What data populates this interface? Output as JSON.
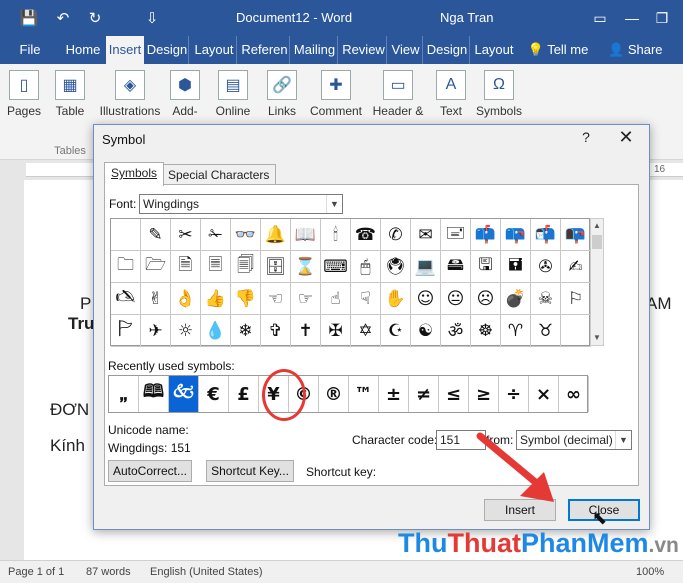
{
  "titlebar": {
    "doc_title": "Document12 - Word",
    "user": "Nga Tran",
    "save_icon": "💾",
    "undo_icon": "↶",
    "redo_icon": "↻",
    "qat_more": "⇩"
  },
  "tabs": [
    "File",
    "Home",
    "Insert",
    "Design",
    "Layout",
    "Referen",
    "Mailing",
    "Review",
    "View",
    "Design",
    "Layout",
    "Tell me",
    "Share"
  ],
  "ribbon": {
    "groups": [
      "Pages",
      "Table",
      "Illustrations",
      "Add-",
      "Online",
      "Links",
      "Comment",
      "Header &",
      "Text",
      "Symbols"
    ],
    "sub": [
      "Tables"
    ]
  },
  "document": {
    "ruler_label": "16",
    "fragments": [
      "P",
      "Tru",
      "AM",
      "ĐƠN",
      "Kính"
    ]
  },
  "statusbar": {
    "page": "Page 1 of 1",
    "words": "87 words",
    "language": "English (United States)",
    "zoom": "100%"
  },
  "dialog": {
    "title": "Symbol",
    "help": "?",
    "close_icon": "✕",
    "tab_symbols": "Symbols",
    "tab_special": "Special Characters",
    "font_label": "Font:",
    "font_value": "Wingdings",
    "symbol_grid": [
      [
        "",
        "✎",
        "✂",
        "✁",
        "👓",
        "🔔",
        "📖",
        "🕯",
        "☎",
        "✆",
        "✉",
        "🖃",
        "📫",
        "📪",
        "📬",
        "📭"
      ],
      [
        "🗀",
        "🗁",
        "🗎",
        "🗏",
        "🗐",
        "🗄",
        "⌛",
        "⌨",
        "🖱",
        "🖲",
        "💻",
        "🖴",
        "🖫",
        "🖬",
        "✇",
        "✍"
      ],
      [
        "🖎",
        "✌",
        "👌",
        "👍",
        "👎",
        "☜",
        "☞",
        "☝",
        "☟",
        "✋",
        "☺",
        "😐",
        "☹",
        "💣",
        "☠",
        "⚐"
      ],
      [
        "🏱",
        "✈",
        "☼",
        "💧",
        "❄",
        "✞",
        "✝",
        "✠",
        "✡",
        "☪",
        "☯",
        "ॐ",
        "☸",
        "♈",
        "♉",
        ""
      ]
    ],
    "recent_label": "Recently used symbols:",
    "recent_symbols": [
      "🙸",
      "🕮",
      "🙵",
      "€",
      "£",
      "¥",
      "©",
      "®",
      "™",
      "±",
      "≠",
      "≤",
      "≥",
      "÷",
      "×",
      "∞"
    ],
    "unicode_name_label": "Unicode name:",
    "code_info": "Wingdings: 151",
    "char_code_label": "Character code:",
    "char_code_value": "151",
    "from_label": "from:",
    "from_value": "Symbol (decimal)",
    "autocorrect_btn": "AutoCorrect...",
    "shortcut_key_btn": "Shortcut Key...",
    "shortcut_key_label": "Shortcut key:",
    "insert_btn": "Insert",
    "close_btn": "Close"
  },
  "watermark": {
    "part1": "Thu",
    "part2": "Thuat",
    "part3": "PhanMem",
    "part4": ".vn"
  },
  "colors": {
    "word_blue": "#2b579a",
    "selection_blue": "#0a64d6",
    "annotation_red": "#e53935"
  }
}
